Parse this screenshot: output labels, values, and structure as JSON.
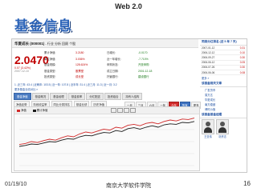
{
  "slide": {
    "title": "Web 2.0",
    "heading": "基金信息",
    "footer_date": "01/19/10",
    "footer_org": "南京大学软件学院",
    "page_number": "16"
  },
  "fund": {
    "name": "华夏成长 (000001)",
    "toolbar_text": "- 行业 分析 回顾 个股",
    "price": "2.0470",
    "change": "0.07 (3.42%)",
    "date": "2007-12-10",
    "stats_rows": [
      [
        "累计净值:",
        "3.2180",
        "日增长:",
        "-0.0170"
      ],
      [
        "单位净值:",
        "3.036%",
        "近一年增长:",
        "-7.710%"
      ],
      [
        "基金规模:",
        "128.624%",
        "申购状态:",
        "开放申购"
      ],
      [
        "基金类型:",
        "股票型",
        "成立日期:",
        "2001-12-18"
      ],
      [
        "投资类型:",
        "成长型",
        "托管银行:",
        "建设银行"
      ]
    ],
    "blue_line": "1. 近三年: 43.4 | 近两年: 103.5 | 近一年: 107.8 | 近半年: 31.4 | 近三月: 11.3 | 近一月: 3.2",
    "blue_line2": "更多基金业绩对比 »"
  },
  "nav": {
    "tabs": [
      "基金净值",
      "基金概况",
      "基金经理",
      "基金费率",
      "分红配送",
      "投资组合",
      "持有人结构"
    ],
    "active_tab": 0,
    "subtabs": [
      "净值走势",
      "阶段收益率",
      "同比分类排名",
      "基金业绩",
      "历史净值"
    ],
    "chart_buttons": [
      "一月",
      "三月",
      "六月",
      "一年",
      "今年",
      "所有",
      "更多"
    ]
  },
  "chart_panel": {
    "legend_a": "净值",
    "legend_b": "累计净值",
    "tool_icons": [
      "zoom-in-icon",
      "zoom-out-icon",
      "reset-icon",
      "print-icon"
    ]
  },
  "chart_data": {
    "type": "line",
    "title": "",
    "x_label": "",
    "y_label": "",
    "series": [
      {
        "name": "净值",
        "color": "#d12a2a",
        "values": [
          0.44,
          0.46,
          0.5,
          0.48,
          0.52,
          0.55,
          0.53,
          0.58,
          0.62,
          0.6,
          0.66,
          0.7,
          0.68,
          0.72,
          0.76,
          0.74,
          0.8,
          0.78,
          0.84,
          0.86,
          0.83,
          0.88,
          0.9,
          0.87,
          0.92,
          0.95,
          0.93,
          0.97,
          0.96,
          0.99
        ]
      },
      {
        "name": "累计净值",
        "color": "#1b1b1b",
        "values": [
          0.4,
          0.42,
          0.45,
          0.44,
          0.47,
          0.5,
          0.49,
          0.53,
          0.56,
          0.55,
          0.6,
          0.63,
          0.62,
          0.66,
          0.69,
          0.68,
          0.73,
          0.71,
          0.77,
          0.79,
          0.76,
          0.8,
          0.83,
          0.8,
          0.85,
          0.87,
          0.86,
          0.9,
          0.89,
          0.92
        ]
      }
    ]
  },
  "sidebar": {
    "nav_title": "同类分红排名 (近 5 年 7 天)",
    "nav_rows": [
      [
        "2007-01-12",
        "0.31"
      ],
      [
        "2006-12-12",
        "0.10"
      ],
      [
        "2006-09-27",
        "0.30"
      ],
      [
        "2006-06-12",
        "0.05"
      ],
      [
        "2006-07-26",
        "0.30"
      ],
      [
        "2006-06-06",
        "0.08"
      ]
    ],
    "more": "更多 »",
    "related_title": "该基金相关文章",
    "related": [
      "广发货币",
      "易方达",
      "华夏成长",
      "南方稳健",
      "博时价值"
    ],
    "manager_title": "该基金基金经理",
    "managers": [
      "王亚伟",
      "巩怀志"
    ]
  }
}
